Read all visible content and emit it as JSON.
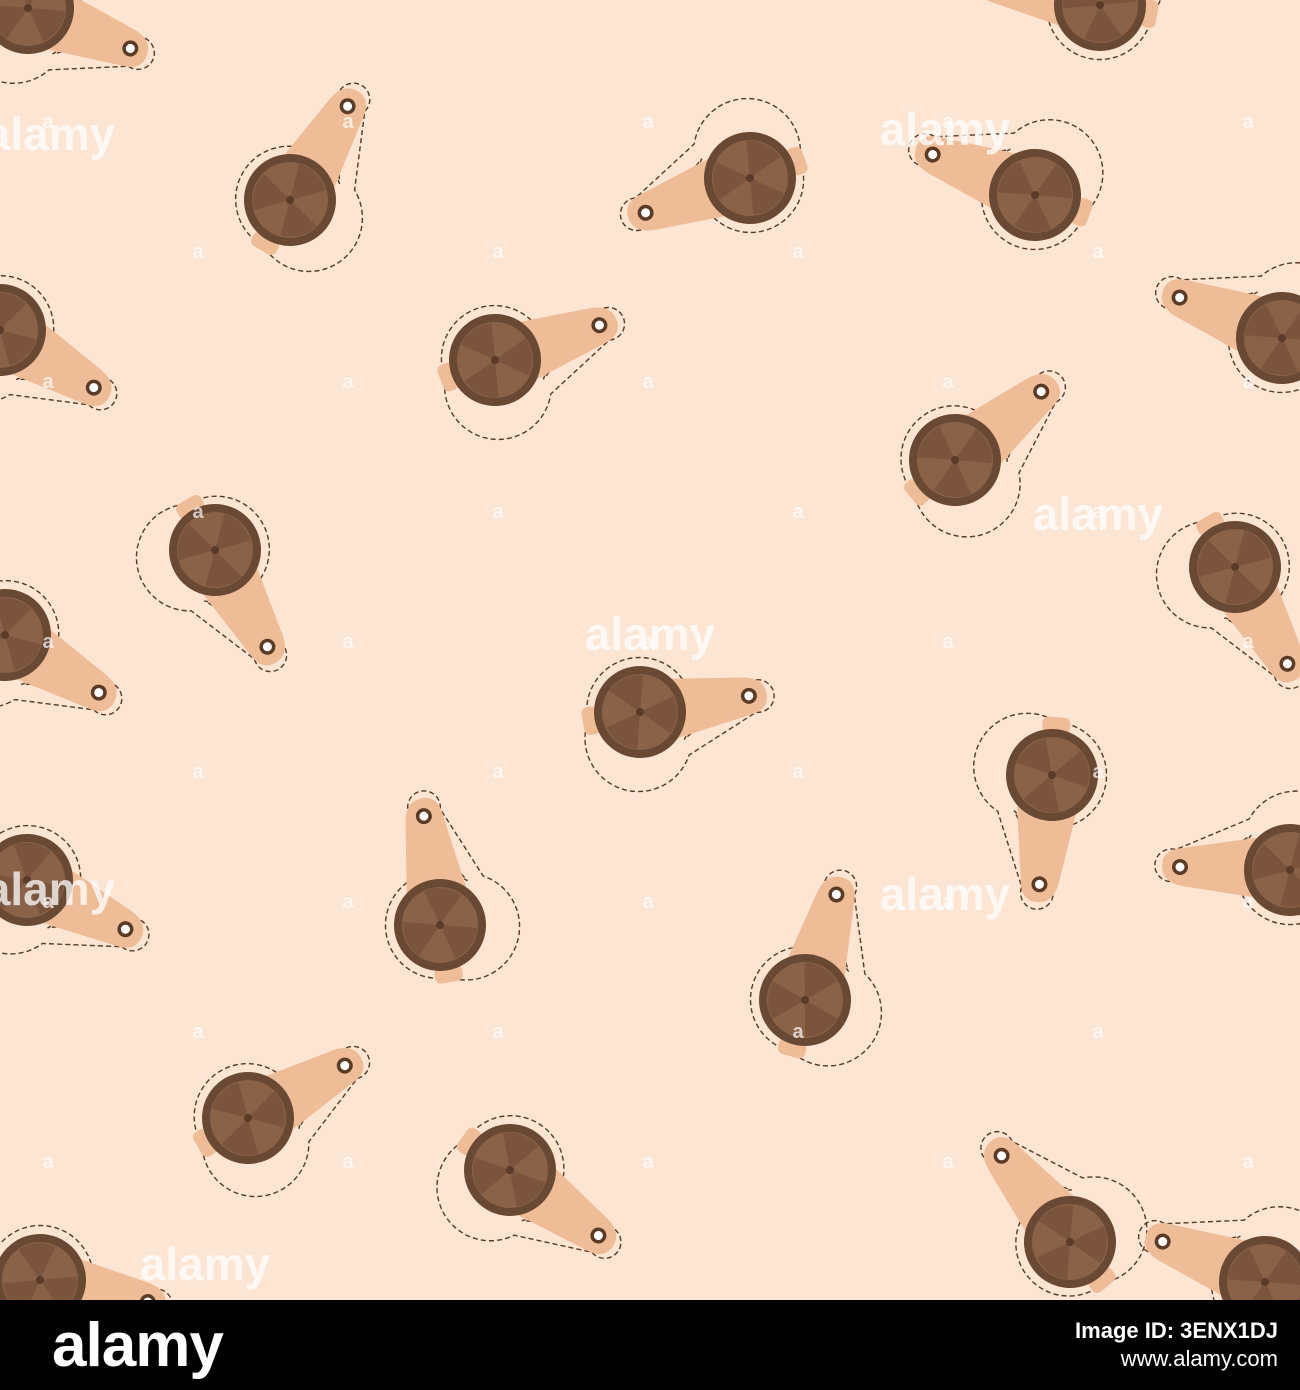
{
  "image": {
    "subject": "seamless pattern of peeler tools",
    "background_color": "#fde5d4",
    "handle_color": "#eebd98",
    "cup_color": "#6a4934",
    "blade_color": "#8a6248",
    "stitch_color": "#5c3b26",
    "hole_color": "#ffffff",
    "watermark_text": "alamy",
    "watermark_color": "#ffffff"
  },
  "footer": {
    "logo_text": "alamy",
    "image_id": "Image ID: 3ENX1DJ",
    "url": "www.alamy.com"
  }
}
